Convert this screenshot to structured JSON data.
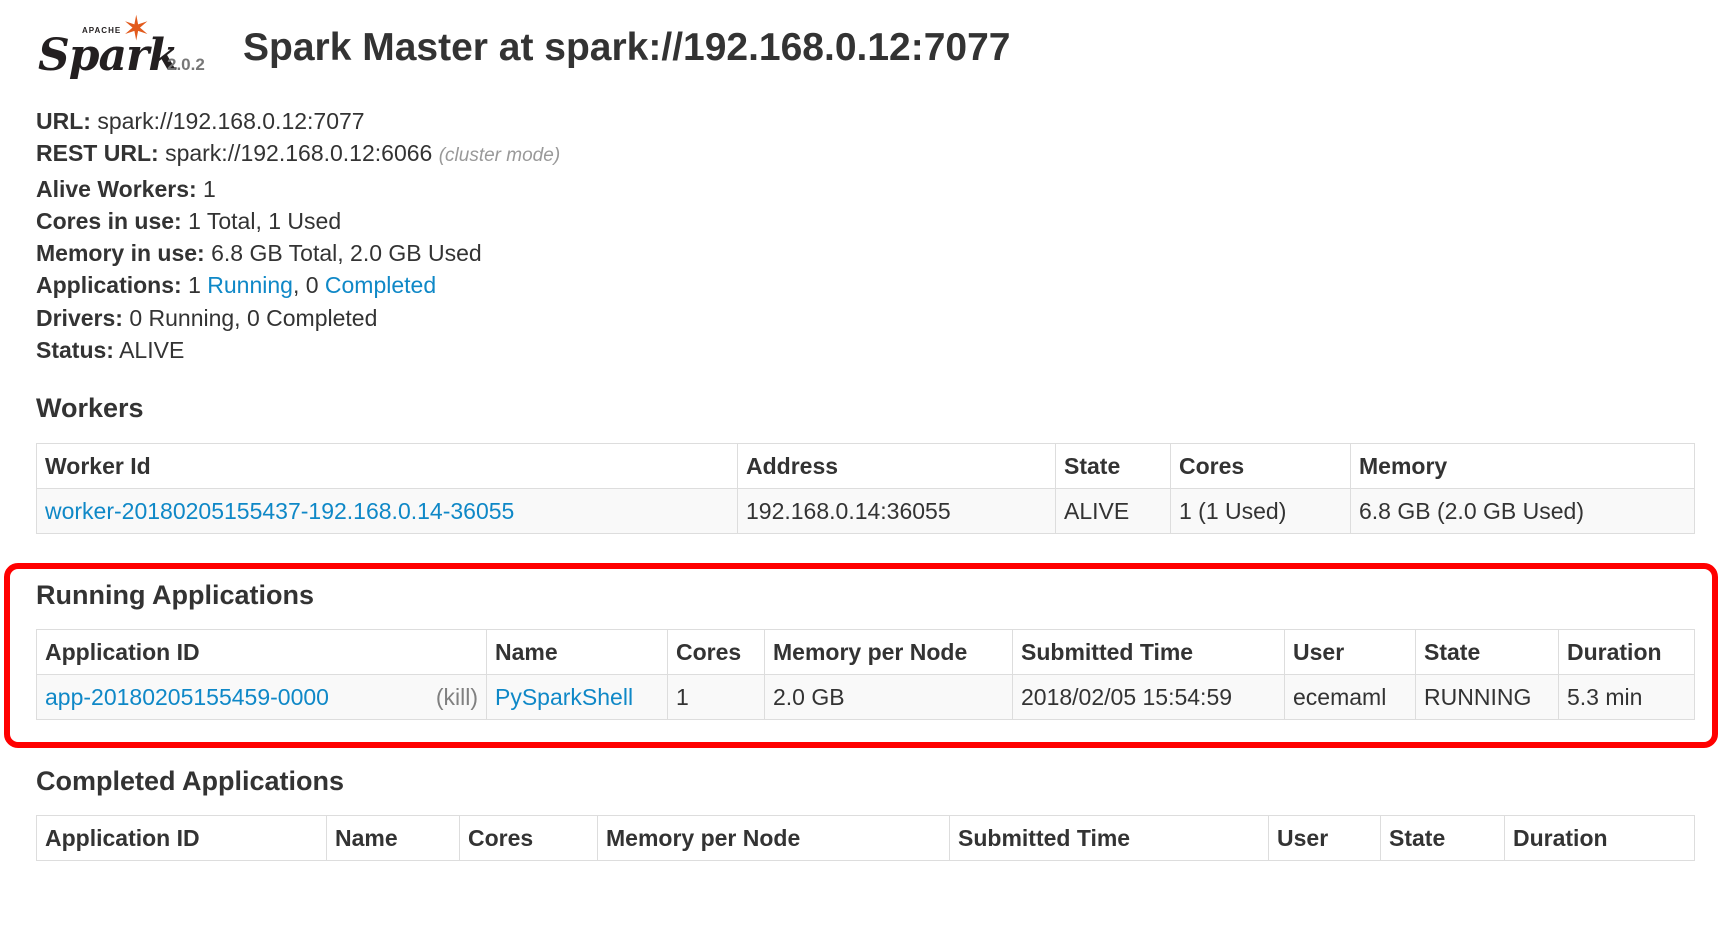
{
  "header": {
    "logo_text": "Spark",
    "logo_apache": "APACHE",
    "version": "2.0.2",
    "title": "Spark Master at spark://192.168.0.12:7077"
  },
  "summary": {
    "url_label": "URL:",
    "url_value": "spark://192.168.0.12:7077",
    "rest_label": "REST URL:",
    "rest_value": "spark://192.168.0.12:6066",
    "rest_note": "(cluster mode)",
    "alive_label": "Alive Workers:",
    "alive_value": "1",
    "cores_label": "Cores in use:",
    "cores_value": "1 Total, 1 Used",
    "memory_label": "Memory in use:",
    "memory_value": "6.8 GB Total, 2.0 GB Used",
    "apps_label": "Applications:",
    "apps_running_count": "1",
    "apps_running_link": "Running",
    "apps_completed_count": "0",
    "apps_completed_link": "Completed",
    "drivers_label": "Drivers:",
    "drivers_value": "0 Running, 0 Completed",
    "status_label": "Status:",
    "status_value": "ALIVE"
  },
  "workers": {
    "title": "Workers",
    "headers": [
      "Worker Id",
      "Address",
      "State",
      "Cores",
      "Memory"
    ],
    "rows": [
      {
        "id": "worker-20180205155437-192.168.0.14-36055",
        "address": "192.168.0.14:36055",
        "state": "ALIVE",
        "cores": "1 (1 Used)",
        "memory": "6.8 GB (2.0 GB Used)"
      }
    ]
  },
  "running": {
    "title": "Running Applications",
    "headers": [
      "Application ID",
      "Name",
      "Cores",
      "Memory per Node",
      "Submitted Time",
      "User",
      "State",
      "Duration"
    ],
    "rows": [
      {
        "id": "app-20180205155459-0000",
        "kill": "(kill)",
        "name": "PySparkShell",
        "cores": "1",
        "memory": "2.0 GB",
        "submitted": "2018/02/05 15:54:59",
        "user": "ecemaml",
        "state": "RUNNING",
        "duration": "5.3 min"
      }
    ]
  },
  "completed": {
    "title": "Completed Applications",
    "headers": [
      "Application ID",
      "Name",
      "Cores",
      "Memory per Node",
      "Submitted Time",
      "User",
      "State",
      "Duration"
    ]
  },
  "colors": {
    "link": "#0f88c7",
    "highlight": "#ff0000",
    "logo_star": "#e25a1c"
  }
}
